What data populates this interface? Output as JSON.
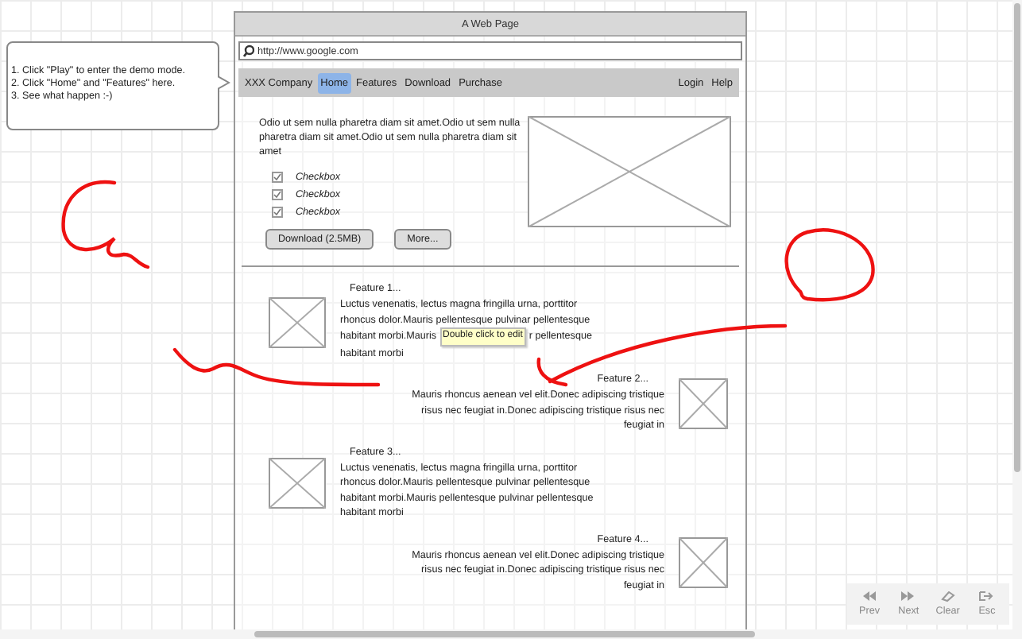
{
  "callout": {
    "lines": [
      "1. Click \"Play\" to enter the demo mode.",
      "2. Click \"Home\" and \"Features\" here.",
      "3. See what happen :-)"
    ]
  },
  "window": {
    "title": "A Web Page"
  },
  "address_bar": {
    "value": "http://www.google.com"
  },
  "nav": {
    "brand": "XXX Company",
    "items": [
      {
        "label": "Home",
        "selected": true
      },
      {
        "label": "Features",
        "selected": false
      },
      {
        "label": "Download",
        "selected": false
      },
      {
        "label": "Purchase",
        "selected": false
      }
    ],
    "right_items": [
      "Login",
      "Help"
    ]
  },
  "intro": {
    "text": "Odio ut sem nulla pharetra diam sit amet.Odio ut sem nulla pharetra diam sit amet.Odio ut sem nulla pharetra diam sit amet",
    "checkboxes": [
      {
        "label": "Checkbox",
        "checked": true
      },
      {
        "label": "Checkbox",
        "checked": true
      },
      {
        "label": "Checkbox",
        "checked": true
      }
    ],
    "buttons": [
      "Download (2.5MB)",
      "More..."
    ]
  },
  "features": [
    {
      "kind": "left",
      "title": "Feature 1...",
      "text": "Luctus venenatis, lectus magna fringilla urna, porttitor rhoncus dolor.Mauris pellentesque pulvinar pellentesque",
      "tooltip_line": {
        "before": "habitant morbi.Mauris",
        "tooltip": "Double click to edit",
        "after": "r pellentesque"
      },
      "text_after": "habitant morbi"
    },
    {
      "kind": "right",
      "title": "Feature 2...",
      "text": "Mauris rhoncus aenean vel elit.Donec adipiscing tristique risus nec feugiat in.Donec adipiscing tristique risus nec feugiat in"
    },
    {
      "kind": "left",
      "title": "Feature 3...",
      "text": "Luctus venenatis, lectus magna fringilla urna, porttitor rhoncus dolor.Mauris pellentesque pulvinar pellentesque habitant morbi.Mauris pellentesque pulvinar pellentesque habitant morbi"
    },
    {
      "kind": "right",
      "title": "Feature 4...",
      "text": "Mauris rhoncus aenean vel elit.Donec adipiscing tristique risus nec feugiat in.Donec adipiscing tristique risus nec feugiat in"
    }
  ],
  "presentation_toolbar": [
    {
      "kind": "prev",
      "label": "Prev"
    },
    {
      "kind": "next",
      "label": "Next"
    },
    {
      "kind": "clear",
      "label": "Clear"
    },
    {
      "kind": "esc",
      "label": "Esc"
    }
  ]
}
